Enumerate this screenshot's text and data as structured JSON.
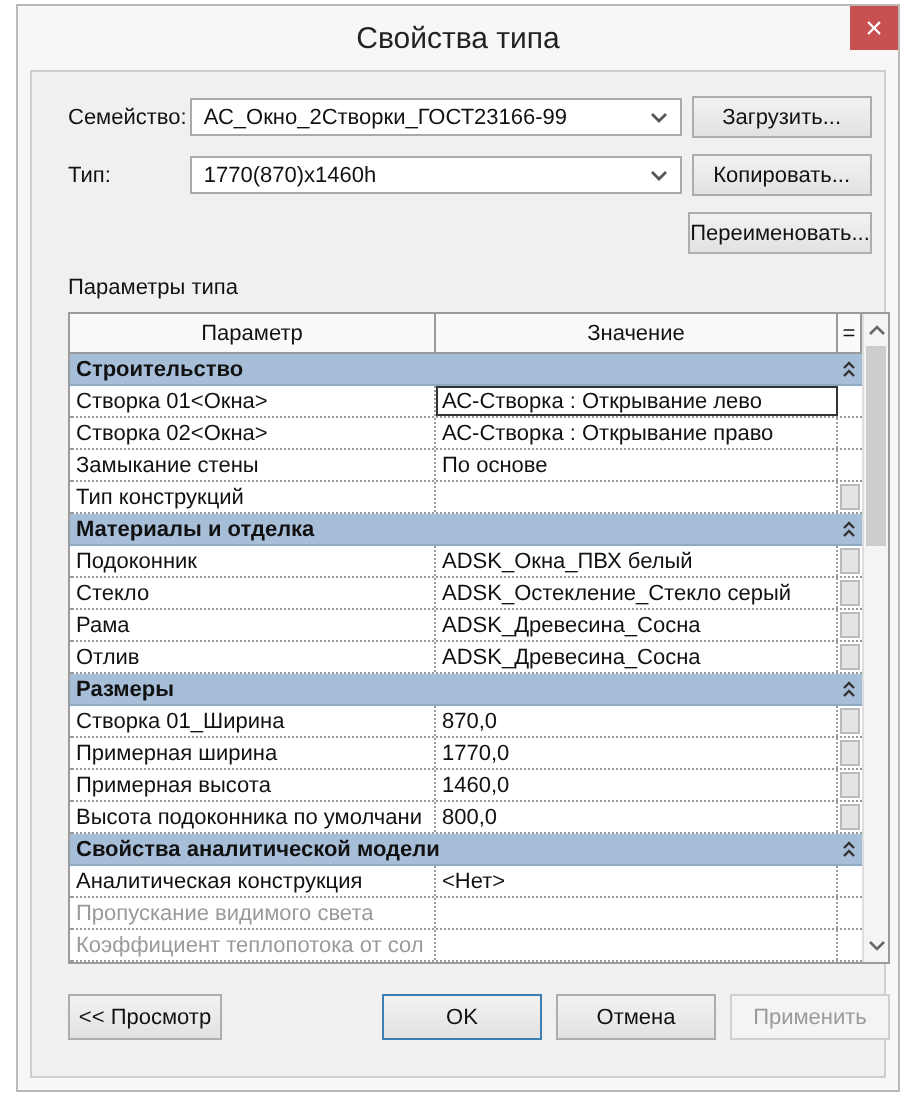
{
  "window": {
    "title": "Свойства типа",
    "close": "×"
  },
  "family": {
    "label": "Семейство:",
    "value": "АС_Окно_2Створки_ГОСТ23166-99"
  },
  "type": {
    "label": "Тип:",
    "value": "1770(870)x1460h"
  },
  "side_buttons": [
    "Загрузить...",
    "Копировать...",
    "Переименовать..."
  ],
  "section_label": "Параметры типа",
  "table": {
    "columns": [
      "Параметр",
      "Значение",
      "="
    ],
    "rows": [
      {
        "kind": "group",
        "name": "Строительство"
      },
      {
        "kind": "param",
        "name": "Створка 01<Окна>",
        "value": "АС-Створка : Открывание лево",
        "focused": true,
        "has_button": false,
        "disabled": false
      },
      {
        "kind": "param",
        "name": "Створка 02<Окна>",
        "value": "АС-Створка : Открывание право",
        "focused": false,
        "has_button": false,
        "disabled": false
      },
      {
        "kind": "param",
        "name": "Замыкание стены",
        "value": "По основе",
        "focused": false,
        "has_button": false,
        "disabled": false
      },
      {
        "kind": "param",
        "name": "Тип конструкций",
        "focused": false,
        "has_button": true,
        "disabled": false
      },
      {
        "kind": "group",
        "name": "Материалы и отделка"
      },
      {
        "kind": "param",
        "name": "Подоконник",
        "value": "ADSK_Окна_ПВХ белый",
        "focused": false,
        "has_button": true,
        "disabled": false
      },
      {
        "kind": "param",
        "name": "Стекло",
        "value": "ADSK_Остекление_Стекло серый",
        "focused": false,
        "has_button": true,
        "disabled": false
      },
      {
        "kind": "param",
        "name": "Рама",
        "value": "ADSK_Древесина_Сосна",
        "focused": false,
        "has_button": true,
        "disabled": false
      },
      {
        "kind": "param",
        "name": "Отлив",
        "value": "ADSK_Древесина_Сосна",
        "focused": false,
        "has_button": true,
        "disabled": false
      },
      {
        "kind": "group",
        "name": "Размеры"
      },
      {
        "kind": "param",
        "name": "Створка 01_Ширина",
        "value": "870,0",
        "focused": false,
        "has_button": true,
        "disabled": false
      },
      {
        "kind": "param",
        "name": "Примерная ширина",
        "value": "1770,0",
        "focused": false,
        "has_button": true,
        "disabled": false
      },
      {
        "kind": "param",
        "name": "Примерная высота",
        "value": "1460,0",
        "focused": false,
        "has_button": true,
        "disabled": false
      },
      {
        "kind": "param",
        "name": "Высота подоконника по умолчани",
        "value": "800,0",
        "focused": false,
        "has_button": true,
        "disabled": false
      },
      {
        "kind": "group",
        "name": "Свойства аналитической модели"
      },
      {
        "kind": "param",
        "name": "Аналитическая конструкция",
        "value": "<Нет>",
        "focused": false,
        "has_button": false,
        "disabled": false
      },
      {
        "kind": "param",
        "name": "Пропускание видимого света",
        "focused": false,
        "has_button": false,
        "disabled": true
      },
      {
        "kind": "param",
        "name": "Коэффициент теплопотока от сол",
        "focused": false,
        "has_button": false,
        "disabled": true
      }
    ]
  },
  "footer": {
    "preview": "<< Просмотр",
    "buttons": [
      {
        "label": "OK",
        "disabled": false,
        "default": true
      },
      {
        "label": "Отмена",
        "disabled": false,
        "default": false
      },
      {
        "label": "Применить",
        "disabled": true,
        "default": false
      }
    ]
  }
}
